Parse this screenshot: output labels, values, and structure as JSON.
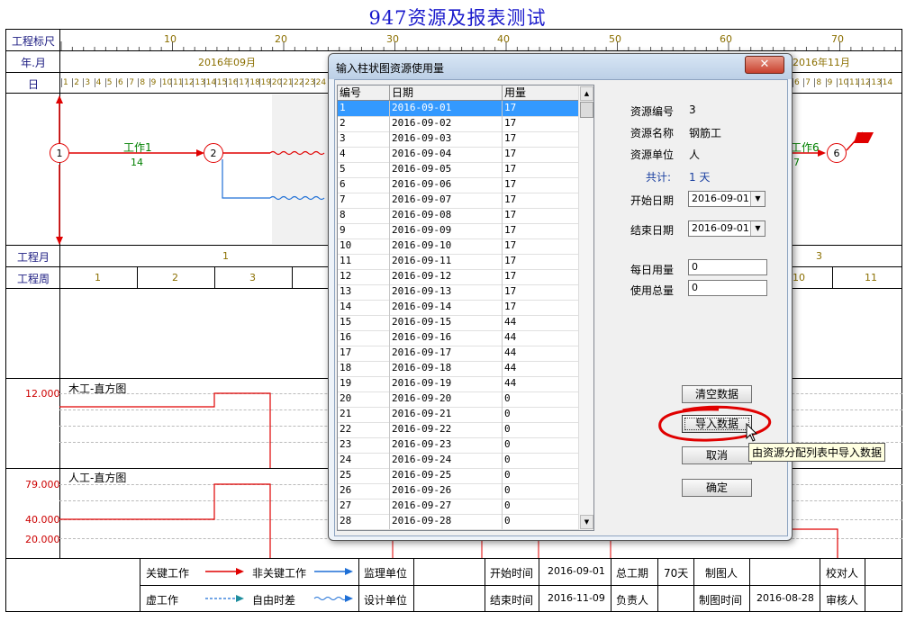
{
  "title": "947资源及报表测试",
  "rows": {
    "scale": "工程标尺",
    "month": "年.月",
    "day": "日",
    "proj_month": "工程月",
    "proj_week": "工程周"
  },
  "scale_ticks": [
    "10",
    "20",
    "30",
    "40",
    "50",
    "60",
    "70"
  ],
  "months": [
    "2016年09月",
    "2016年11月"
  ],
  "days_left": [
    "1",
    "2",
    "3",
    "4",
    "5",
    "6",
    "7",
    "8",
    "9",
    "10",
    "11",
    "12",
    "13",
    "14",
    "15",
    "16",
    "17",
    "18",
    "19",
    "20",
    "21",
    "22",
    "23",
    "24"
  ],
  "days_right": [
    "6",
    "7",
    "8",
    "9",
    "10",
    "11",
    "12",
    "13",
    "14"
  ],
  "proj_month_values": [
    "1",
    "3"
  ],
  "proj_week_values": [
    "1",
    "2",
    "3",
    "10",
    "11"
  ],
  "network": {
    "nodes": [
      "1",
      "2",
      "6"
    ],
    "task1_name": "工作1",
    "task1_dur": "14",
    "task6_name": "工作6",
    "task6_dur": "7"
  },
  "histograms": {
    "h1_name": "木工-直方图",
    "h1_val": "12.000",
    "h2_name": "人工-直方图",
    "h2_val1": "79.000",
    "h2_val2": "40.000",
    "h2_val3": "20.000"
  },
  "legend": {
    "critical": "关键工作",
    "noncritical": "非关键工作",
    "dummy": "虚工作",
    "freefloat": "自由时差",
    "supervise_unit": "监理单位",
    "design_unit": "设计单位",
    "start_time_label": "开始时间",
    "start_time": "2016-09-01",
    "end_time_label": "结束时间",
    "end_time": "2016-11-09",
    "total_label": "总工期",
    "total": "70天",
    "owner_label": "负责人",
    "drafter_label": "制图人",
    "draft_time_label": "制图时间",
    "draft_time": "2016-08-28",
    "checker_label": "校对人",
    "reviewer_label": "审核人"
  },
  "dialog": {
    "title": "输入柱状图资源使用量",
    "close": "✕",
    "columns": [
      "编号",
      "日期",
      "用量"
    ],
    "rows": [
      [
        "1",
        "2016-09-01",
        "17"
      ],
      [
        "2",
        "2016-09-02",
        "17"
      ],
      [
        "3",
        "2016-09-03",
        "17"
      ],
      [
        "4",
        "2016-09-04",
        "17"
      ],
      [
        "5",
        "2016-09-05",
        "17"
      ],
      [
        "6",
        "2016-09-06",
        "17"
      ],
      [
        "7",
        "2016-09-07",
        "17"
      ],
      [
        "8",
        "2016-09-08",
        "17"
      ],
      [
        "9",
        "2016-09-09",
        "17"
      ],
      [
        "10",
        "2016-09-10",
        "17"
      ],
      [
        "11",
        "2016-09-11",
        "17"
      ],
      [
        "12",
        "2016-09-12",
        "17"
      ],
      [
        "13",
        "2016-09-13",
        "17"
      ],
      [
        "14",
        "2016-09-14",
        "17"
      ],
      [
        "15",
        "2016-09-15",
        "44"
      ],
      [
        "16",
        "2016-09-16",
        "44"
      ],
      [
        "17",
        "2016-09-17",
        "44"
      ],
      [
        "18",
        "2016-09-18",
        "44"
      ],
      [
        "19",
        "2016-09-19",
        "44"
      ],
      [
        "20",
        "2016-09-20",
        "0"
      ],
      [
        "21",
        "2016-09-21",
        "0"
      ],
      [
        "22",
        "2016-09-22",
        "0"
      ],
      [
        "23",
        "2016-09-23",
        "0"
      ],
      [
        "24",
        "2016-09-24",
        "0"
      ],
      [
        "25",
        "2016-09-25",
        "0"
      ],
      [
        "26",
        "2016-09-26",
        "0"
      ],
      [
        "27",
        "2016-09-27",
        "0"
      ],
      [
        "28",
        "2016-09-28",
        "0"
      ]
    ],
    "resource_no_label": "资源编号",
    "resource_no": "3",
    "resource_name_label": "资源名称",
    "resource_name": "钢筋工",
    "resource_unit_label": "资源单位",
    "resource_unit": "人",
    "total_label": "共计:",
    "total_value": "1 天",
    "start_label": "开始日期",
    "start_value": "2016-09-01",
    "end_label": "结束日期",
    "end_value": "2016-09-01",
    "daily_label": "每日用量",
    "daily_value": "0",
    "sum_label": "使用总量",
    "sum_value": "0",
    "btn_clear": "清空数据",
    "btn_import": "导入数据",
    "btn_cancel": "取消",
    "btn_ok": "确定",
    "tooltip": "由资源分配列表中导入数据"
  }
}
